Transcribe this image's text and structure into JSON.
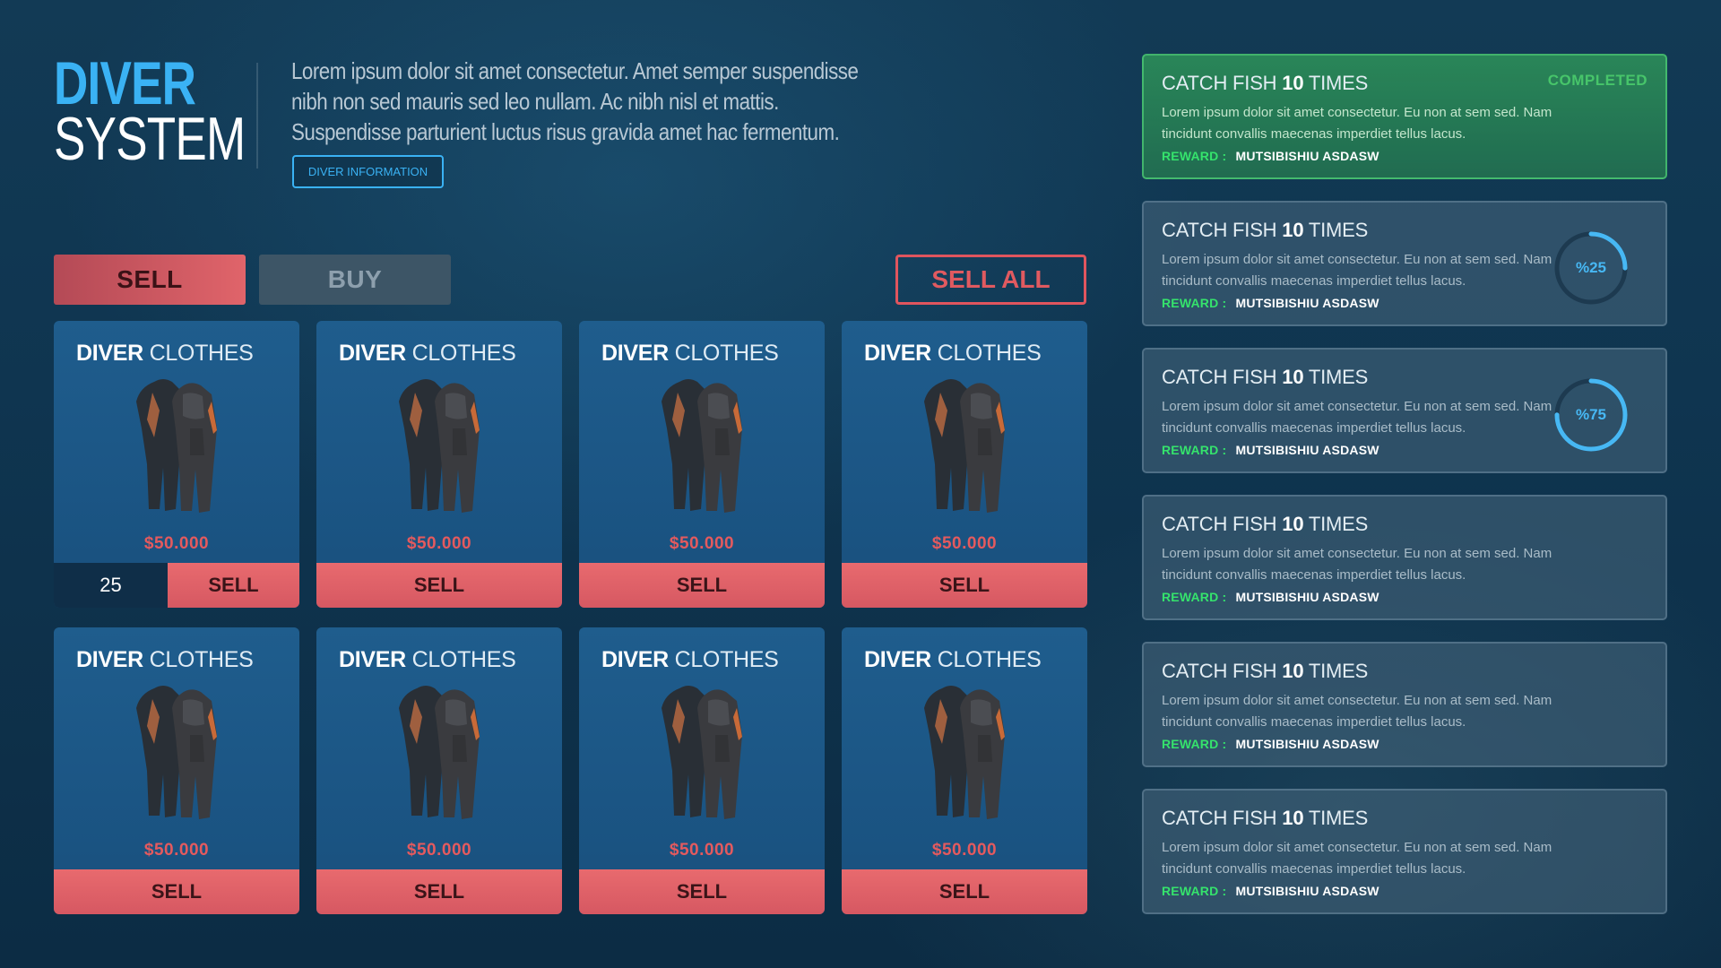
{
  "brand": {
    "line1": "DIVER",
    "line2": "SYSTEM"
  },
  "intro": "Lorem ipsum dolor sit amet consectetur. Amet semper suspendisse nibh non sed mauris sed leo nullam. Ac nibh nisl et mattis. Suspendisse parturient luctus risus gravida amet hac fermentum.",
  "info_button": "DIVER INFORMATION",
  "tabs": {
    "sell": "SELL",
    "buy": "BUY",
    "active": "sell"
  },
  "sell_all": "SELL ALL",
  "cards": [
    {
      "title_bold": "DIVER",
      "title_light": "CLOTHES",
      "price": "$50.000",
      "sell": "SELL",
      "quantity": "25"
    },
    {
      "title_bold": "DIVER",
      "title_light": "CLOTHES",
      "price": "$50.000",
      "sell": "SELL"
    },
    {
      "title_bold": "DIVER",
      "title_light": "CLOTHES",
      "price": "$50.000",
      "sell": "SELL"
    },
    {
      "title_bold": "DIVER",
      "title_light": "CLOTHES",
      "price": "$50.000",
      "sell": "SELL"
    },
    {
      "title_bold": "DIVER",
      "title_light": "CLOTHES",
      "price": "$50.000",
      "sell": "SELL"
    },
    {
      "title_bold": "DIVER",
      "title_light": "CLOTHES",
      "price": "$50.000",
      "sell": "SELL"
    },
    {
      "title_bold": "DIVER",
      "title_light": "CLOTHES",
      "price": "$50.000",
      "sell": "SELL"
    },
    {
      "title_bold": "DIVER",
      "title_light": "CLOTHES",
      "price": "$50.000",
      "sell": "SELL"
    }
  ],
  "quests": [
    {
      "title_pre": "CATCH FISH",
      "title_num": "10",
      "title_post": "TIMES",
      "desc": "Lorem ipsum dolor sit amet consectetur. Eu non at sem sed. Nam tincidunt convallis maecenas imperdiet tellus lacus.",
      "reward_label": "REWARD :",
      "reward_value": "MUTSIBISHIU ASDASW",
      "status": "COMPLETED"
    },
    {
      "title_pre": "CATCH FISH",
      "title_num": "10",
      "title_post": "TIMES",
      "desc": "Lorem ipsum dolor sit amet consectetur. Eu non at sem sed. Nam tincidunt convallis maecenas imperdiet tellus lacus.",
      "reward_label": "REWARD :",
      "reward_value": "MUTSIBISHIU ASDASW",
      "progress_label": "%25",
      "progress": 0.25
    },
    {
      "title_pre": "CATCH FISH",
      "title_num": "10",
      "title_post": "TIMES",
      "desc": "Lorem ipsum dolor sit amet consectetur. Eu non at sem sed. Nam tincidunt convallis maecenas imperdiet tellus lacus.",
      "reward_label": "REWARD :",
      "reward_value": "MUTSIBISHIU ASDASW",
      "progress_label": "%75",
      "progress": 0.75
    },
    {
      "title_pre": "CATCH FISH",
      "title_num": "10",
      "title_post": "TIMES",
      "desc": "Lorem ipsum dolor sit amet consectetur. Eu non at sem sed. Nam tincidunt convallis maecenas imperdiet tellus lacus.",
      "reward_label": "REWARD :",
      "reward_value": "MUTSIBISHIU ASDASW"
    },
    {
      "title_pre": "CATCH FISH",
      "title_num": "10",
      "title_post": "TIMES",
      "desc": "Lorem ipsum dolor sit amet consectetur. Eu non at sem sed. Nam tincidunt convallis maecenas imperdiet tellus lacus.",
      "reward_label": "REWARD :",
      "reward_value": "MUTSIBISHIU ASDASW"
    },
    {
      "title_pre": "CATCH FISH",
      "title_num": "10",
      "title_post": "TIMES",
      "desc": "Lorem ipsum dolor sit amet consectetur. Eu non at sem sed. Nam tincidunt convallis maecenas imperdiet tellus lacus.",
      "reward_label": "REWARD :",
      "reward_value": "MUTSIBISHIU ASDASW"
    }
  ],
  "colors": {
    "accent": "#3ab2f4",
    "sell": "#e0646a",
    "reward": "#35e36c",
    "completed": "#47c56a"
  },
  "icons": {
    "card_item": "wetsuit-icon",
    "quest_progress": "progress-ring-icon"
  }
}
